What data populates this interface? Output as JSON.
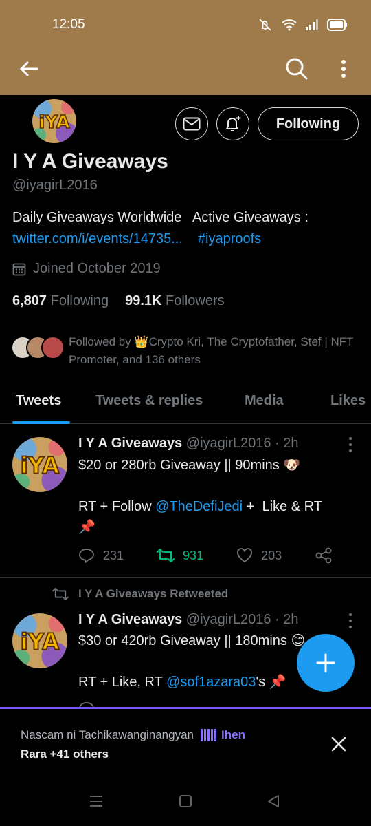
{
  "status_bar": {
    "time": "12:05"
  },
  "profile": {
    "name": "I Y A Giveaways",
    "handle": "@iyagirL2016",
    "bio_line": "Daily Giveaways Worldwide   Active Giveaways :",
    "bio_link": "twitter.com/i/events/14735...",
    "bio_hashtag": "#iyaproofs",
    "joined": "Joined October 2019",
    "following_count": "6,807",
    "following_label": "Following",
    "followers_count": "99.1K",
    "followers_label": "Followers",
    "followed_by": "Followed by 👑Crypto Kri, The Cryptofather, Stef | NFT Promoter, and 136 others",
    "follow_button": "Following"
  },
  "tabs": [
    {
      "label": "Tweets",
      "active": true
    },
    {
      "label": "Tweets & replies",
      "active": false
    },
    {
      "label": "Media",
      "active": false
    },
    {
      "label": "Likes",
      "active": false
    }
  ],
  "tweets": [
    {
      "name": "I Y A Giveaways",
      "meta": "@iyagirL2016 · 2h",
      "line1": "$20 or 280rb Giveaway || 90mins 🐶",
      "line2_prefix": "RT + Follow ",
      "line2_mention": "@TheDefiJedi",
      "line2_suffix": " +  Like & RT",
      "line3": "📌",
      "replies": "231",
      "retweets": "931",
      "likes": "203"
    },
    {
      "retweeted_by": "I Y A Giveaways Retweeted",
      "name": "I Y A Giveaways",
      "meta": "@iyagirL2016 · 2h",
      "line1": "$30 or 420rb Giveaway || 180mins 😊",
      "line2_prefix": "RT + Like, RT ",
      "line2_mention": "@sof1azara03",
      "line2_suffix": "'s 📌"
    }
  ],
  "spaces_bar": {
    "title": "Nascam ni Tachikawanginangyan",
    "host": "Ihen",
    "listeners": "Rara +41 others"
  },
  "colors": {
    "header_bg": "#9f7a4a",
    "accent": "#1d9bf0",
    "retweet_green": "#00ba7c",
    "spaces_purple": "#7856ff"
  }
}
